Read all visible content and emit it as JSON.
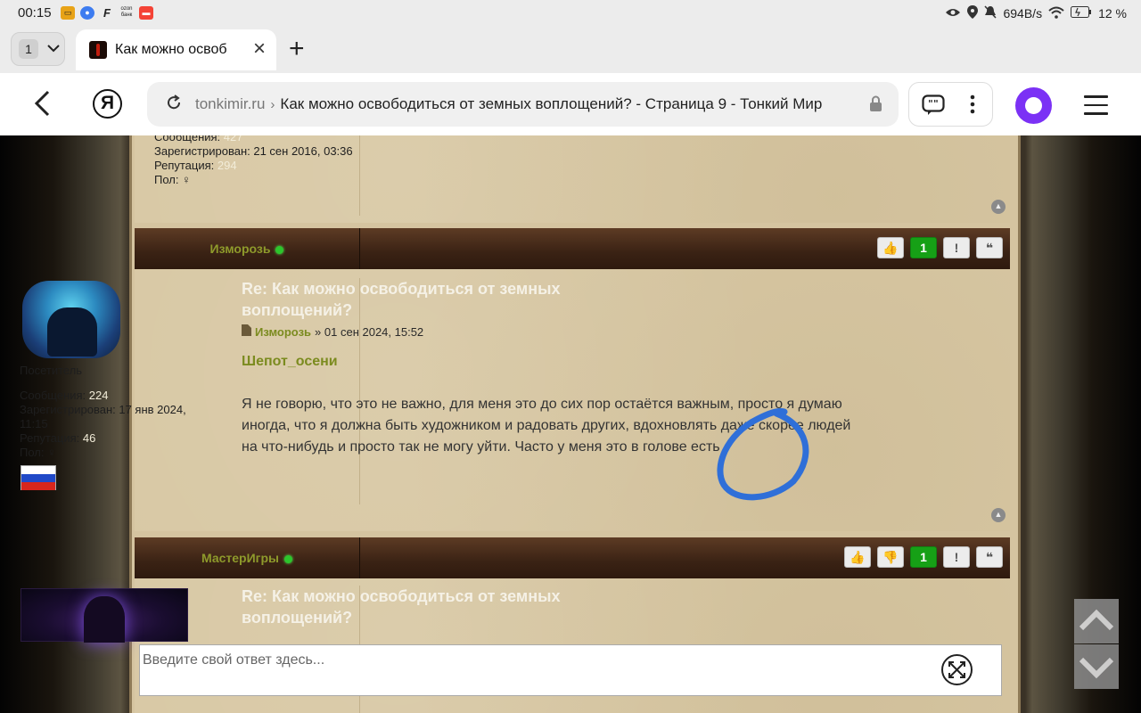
{
  "status_bar": {
    "time": "00:15",
    "network_speed": "694B/s",
    "battery": "12 %",
    "notification_icons": [
      "taxi-app-icon",
      "browser-app-icon",
      "f-app-icon",
      "ozon-bank-icon",
      "red-app-icon"
    ]
  },
  "browser": {
    "tab_count": "1",
    "tab_title": "Как можно освоб",
    "url_domain": "tonkimir.ru",
    "page_title": "Как можно освободиться от земных воплощений? - Страница 9 - Тонкий Мир"
  },
  "prev_post": {
    "messages_label": "Сообщения:",
    "messages": "427",
    "registered_label": "Зарегистрирован:",
    "registered": "21 сен 2016, 03:36",
    "reputation_label": "Репутация:",
    "reputation": "294",
    "gender_label": "Пол:",
    "gender": "♀"
  },
  "post1": {
    "author": "Изморозь",
    "likes": "1",
    "title": "Re: Как можно освободиться от земных воплощений?",
    "meta_author": "Изморозь",
    "meta_date": "» 01 сен 2024, 15:52",
    "rank": "Посетитель",
    "messages_label": "Сообщения:",
    "messages": "224",
    "registered_label": "Зарегистрирован:",
    "registered": "17 янв 2024, 11:15",
    "reputation_label": "Репутация:",
    "reputation": "46",
    "gender_label": "Пол:",
    "gender": "♀",
    "quote_name": "Шепот_осени",
    "body": "Я не говорю, что это не важно, для меня это до сих пор остаётся важным, просто я думаю иногда, что я должна быть художником и радовать других, вдохновлять даже скорее людей на что-нибудь и просто так не могу уйти. Часто у меня это в голове есть"
  },
  "post2": {
    "author": "МастерИгры",
    "likes": "1",
    "title": "Re: Как можно освободиться от земных воплощений?"
  },
  "reply": {
    "placeholder": "Введите свой ответ здесь..."
  },
  "colors": {
    "accent_green": "#16a016",
    "author_olive": "#7b8b1f",
    "post_bar": "#3a2214",
    "annotation_blue": "#2f6fd8"
  }
}
